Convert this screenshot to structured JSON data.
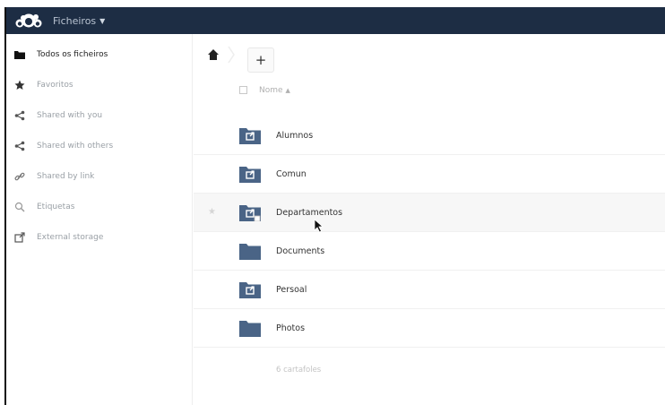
{
  "header": {
    "app_name": "Ficheiros",
    "logo_icon": "cloud-logo-icon",
    "background_color": "#1d2d44"
  },
  "sidebar": {
    "items": [
      {
        "label": "Todos os ficheiros",
        "icon": "folder-icon",
        "active": true
      },
      {
        "label": "Favoritos",
        "icon": "star-icon",
        "active": false
      },
      {
        "label": "Shared with you",
        "icon": "share-icon",
        "active": false
      },
      {
        "label": "Shared with others",
        "icon": "share-icon",
        "active": false
      },
      {
        "label": "Shared by link",
        "icon": "link-icon",
        "active": false
      },
      {
        "label": "Etiquetas",
        "icon": "tag-search-icon",
        "active": false
      },
      {
        "label": "External storage",
        "icon": "external-storage-icon",
        "active": false
      }
    ]
  },
  "toolbar": {
    "new_label": "+",
    "home_icon": "home-icon"
  },
  "table": {
    "name_header": "Nome",
    "sort_indicator": "▲",
    "rows": [
      {
        "name": "Alumnos",
        "icon": "shared-folder-icon"
      },
      {
        "name": "Comun",
        "icon": "shared-folder-icon"
      },
      {
        "name": "Departamentos",
        "icon": "shared-folder-icon"
      },
      {
        "name": "Documents",
        "icon": "folder-icon"
      },
      {
        "name": "Persoal",
        "icon": "shared-folder-icon"
      },
      {
        "name": "Photos",
        "icon": "folder-icon"
      }
    ],
    "summary": "6 cartafoles"
  },
  "colors": {
    "folder": "#4a6486",
    "accent": "#1d2d44"
  }
}
